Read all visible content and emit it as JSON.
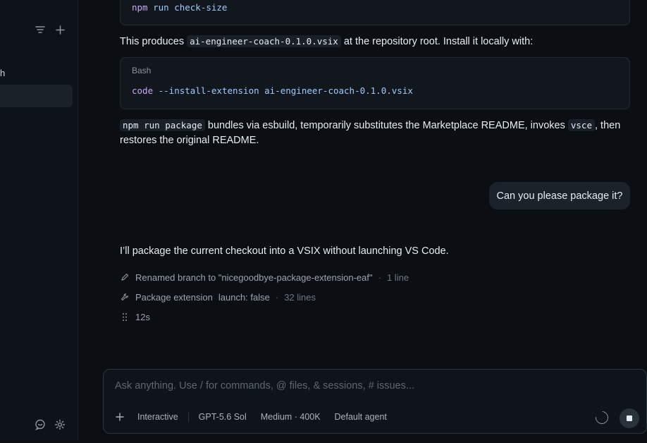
{
  "sidebar": {
    "partial_label": "h",
    "icons": {
      "filter": "filter-icon",
      "add": "plus-icon",
      "feedback": "feedback-icon",
      "settings": "gear-icon"
    }
  },
  "chat": {
    "top_code": {
      "cmd": "npm",
      "args": " run check-size"
    },
    "produces_text": {
      "before": "This produces ",
      "file": "ai-engineer-coach-0.1.0.vsix",
      "after": " at the repository root. Install it locally with:"
    },
    "bash_block": {
      "lang": "Bash",
      "cmd": "code",
      "args": " --install-extension ai-engineer-coach-0.1.0.vsix"
    },
    "package_text": {
      "code1": "npm run package",
      "mid": " bundles via esbuild, temporarily substitutes the Marketplace README, invokes ",
      "code2": "vsce",
      "end": ", then restores the original README."
    },
    "user_message": "Can you please package it?",
    "assistant_reply": "I’ll package the current checkout into a VSIX without launching VS Code.",
    "tool_calls": [
      {
        "icon": "pencil-icon",
        "label": "Renamed branch to \"nicegoodbye-package-extension-eaf\"",
        "arg": "",
        "meta": "1 line"
      },
      {
        "icon": "wrench-icon",
        "label": "Package extension",
        "arg": "launch: false",
        "meta": "32 lines"
      }
    ],
    "progress": {
      "icon": "drag-handle-icon",
      "label": "12s"
    }
  },
  "composer": {
    "placeholder": "Ask anything. Use / for commands, @ files, & sessions, # issues...",
    "value": "",
    "mode": "Interactive",
    "model": "GPT-5.6 Sol",
    "effort": "Medium · 400K",
    "agent": "Default agent"
  }
}
